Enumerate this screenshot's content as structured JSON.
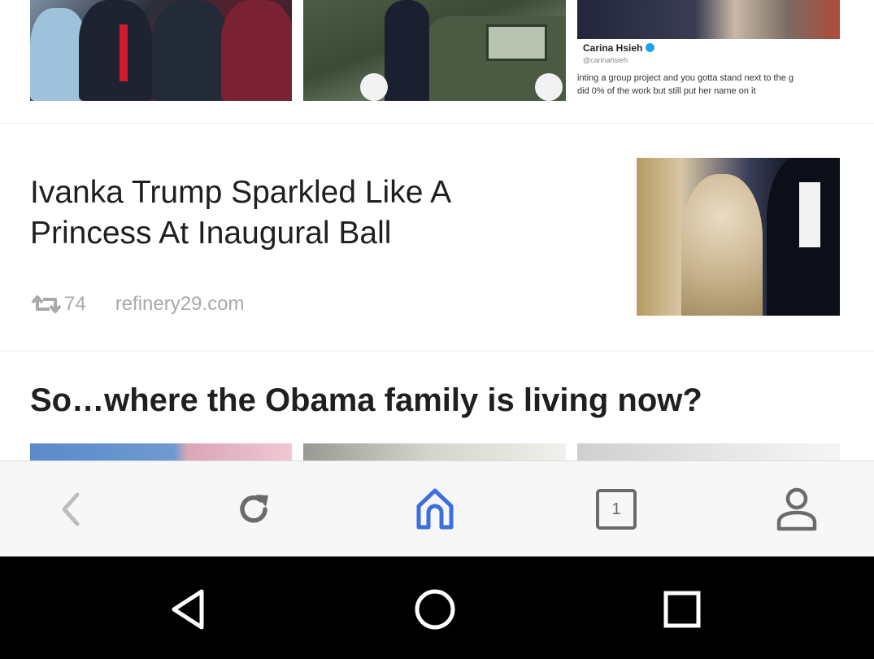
{
  "feed": {
    "top_strip": {
      "tweet": {
        "name": "Carina Hsieh",
        "handle": "@carinahsieh",
        "text_line1": "inting a group project and you gotta stand next to the g",
        "text_line2": "did 0% of the work but still put her name on it"
      }
    },
    "article": {
      "title": "Ivanka Trump Sparkled Like A Princess At Inaugural Ball",
      "repost_count": "74",
      "source": "refinery29.com"
    },
    "section": {
      "title": "So…where the Obama family is living now?"
    }
  },
  "toolbar": {
    "tab_count": "1",
    "icons": [
      "chevron-left-icon",
      "reload-icon",
      "home-icon",
      "tabs-icon",
      "profile-icon"
    ],
    "active_color": "#3b6fe0",
    "inactive_color": "#6b6b6b"
  },
  "navbar": {
    "icons": [
      "back-triangle-icon",
      "home-circle-icon",
      "recents-square-icon"
    ]
  }
}
